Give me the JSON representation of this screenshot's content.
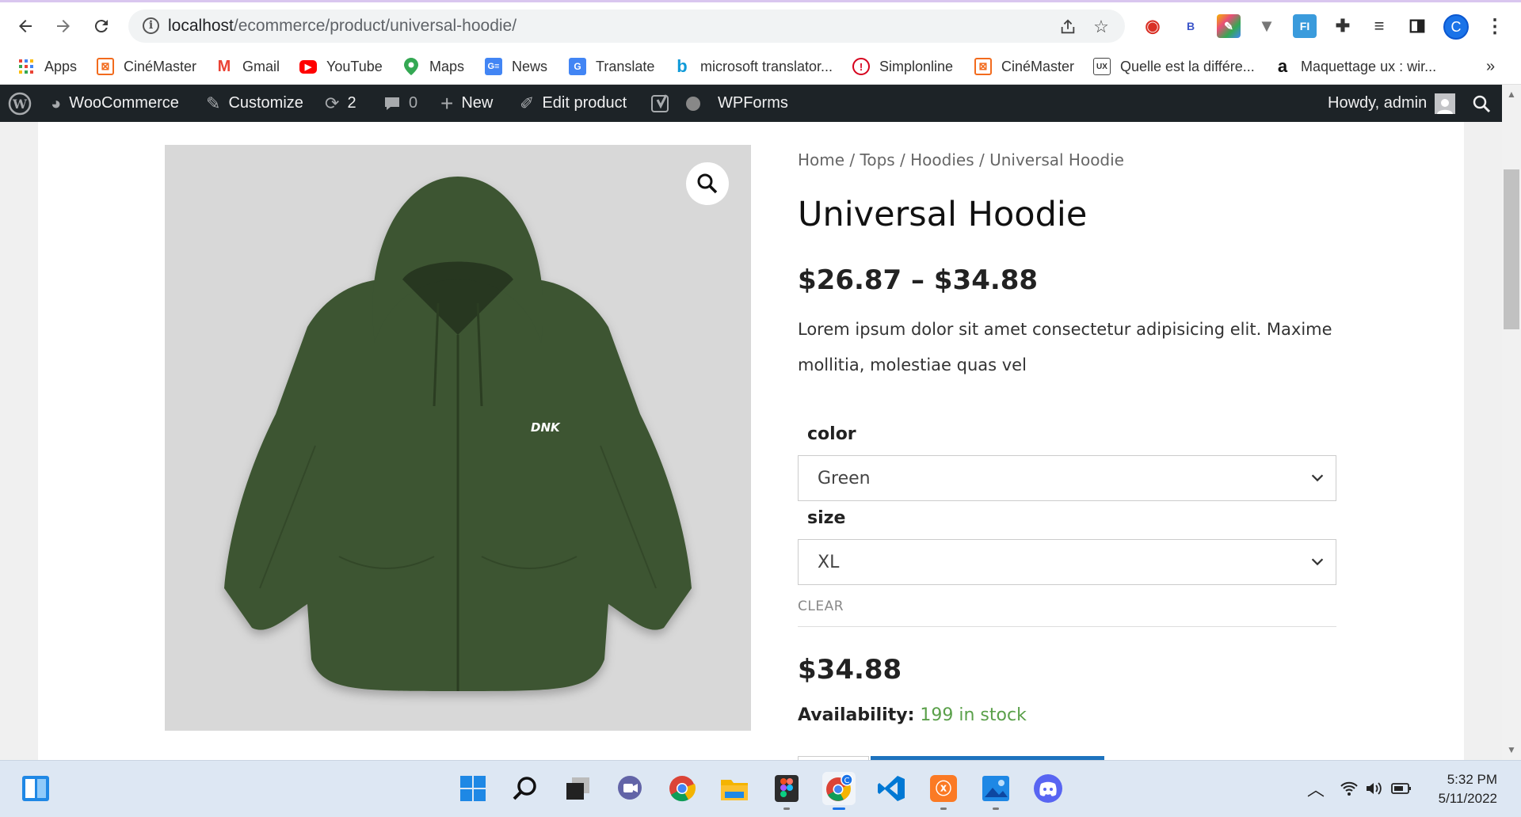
{
  "browser": {
    "url_host": "localhost",
    "url_path": "/ecommerce/product/universal-hoodie/",
    "profile_initial": "C",
    "extensions": [
      {
        "name": "opera-ext-icon",
        "glyph": "◉",
        "color": "#d93025"
      },
      {
        "name": "bitly-ext-icon",
        "glyph": "B",
        "color": "#3b55c9"
      },
      {
        "name": "colorpick-ext-icon",
        "glyph": "▦",
        "color": "#e94e77"
      },
      {
        "name": "vue-devtools-icon",
        "glyph": "V",
        "color": "#777"
      },
      {
        "name": "fi-ext-icon",
        "glyph": "FI",
        "color": "#3a9bdc"
      }
    ]
  },
  "bookmarks": [
    {
      "label": "Apps",
      "icon": "apps-grid-icon",
      "color": "#ea4335",
      "glyph": "⋮⋮"
    },
    {
      "label": "CinéMaster",
      "icon": "cinemaster-icon",
      "color": "#f26b1d",
      "glyph": "☒"
    },
    {
      "label": "Gmail",
      "icon": "gmail-icon",
      "color": "#ea4335",
      "glyph": "M"
    },
    {
      "label": "YouTube",
      "icon": "youtube-icon",
      "color": "#ff0000",
      "glyph": "▶"
    },
    {
      "label": "Maps",
      "icon": "maps-icon",
      "color": "#34a853",
      "glyph": "📍"
    },
    {
      "label": "News",
      "icon": "news-icon",
      "color": "#4285f4",
      "glyph": "G"
    },
    {
      "label": "Translate",
      "icon": "translate-icon",
      "color": "#4285f4",
      "glyph": "G"
    },
    {
      "label": "microsoft translator...",
      "icon": "bing-icon",
      "color": "#0f9ad8",
      "glyph": "b"
    },
    {
      "label": "Simplonline",
      "icon": "simplonline-icon",
      "color": "#d6001c",
      "glyph": "!"
    },
    {
      "label": "CinéMaster",
      "icon": "cinemaster-icon",
      "color": "#f26b1d",
      "glyph": "☒"
    },
    {
      "label": "Quelle est la différe...",
      "icon": "ux-icon",
      "color": "#444",
      "glyph": "UX"
    },
    {
      "label": "Maquettage ux : wir...",
      "icon": "amazon-icon",
      "color": "#111",
      "glyph": "a"
    }
  ],
  "admin_bar": {
    "woocommerce": "WooCommerce",
    "customize": "Customize",
    "updates_count": "2",
    "comments_count": "0",
    "new": "New",
    "edit_product": "Edit product",
    "wpforms": "WPForms",
    "howdy": "Howdy, admin"
  },
  "product": {
    "breadcrumb": [
      "Home",
      "Tops",
      "Hoodies",
      "Universal Hoodie"
    ],
    "title": "Universal Hoodie",
    "price_range": "$26.87 – $34.88",
    "short_description": "Lorem ipsum dolor sit amet consectetur adipisicing elit. Maxime mollitia, molestiae quas vel",
    "image_logo_text": "DNK",
    "hoodie_color": "#3c5431",
    "variations": {
      "color_label": "color",
      "color_value": "Green",
      "size_label": "size",
      "size_value": "XL",
      "clear": "CLEAR"
    },
    "variation_price": "$34.88",
    "availability_label": "Availability:",
    "availability_value": "199 in stock"
  },
  "taskbar": {
    "time": "5:32 PM",
    "date": "5/11/2022",
    "apps": [
      "widgets-icon",
      "start-icon",
      "search-icon",
      "task-view-icon",
      "teams-chat-icon",
      "chrome-icon",
      "file-explorer-icon",
      "figma-icon",
      "chrome-profile-icon",
      "vscode-icon",
      "xampp-icon",
      "photos-icon",
      "discord-icon"
    ]
  }
}
